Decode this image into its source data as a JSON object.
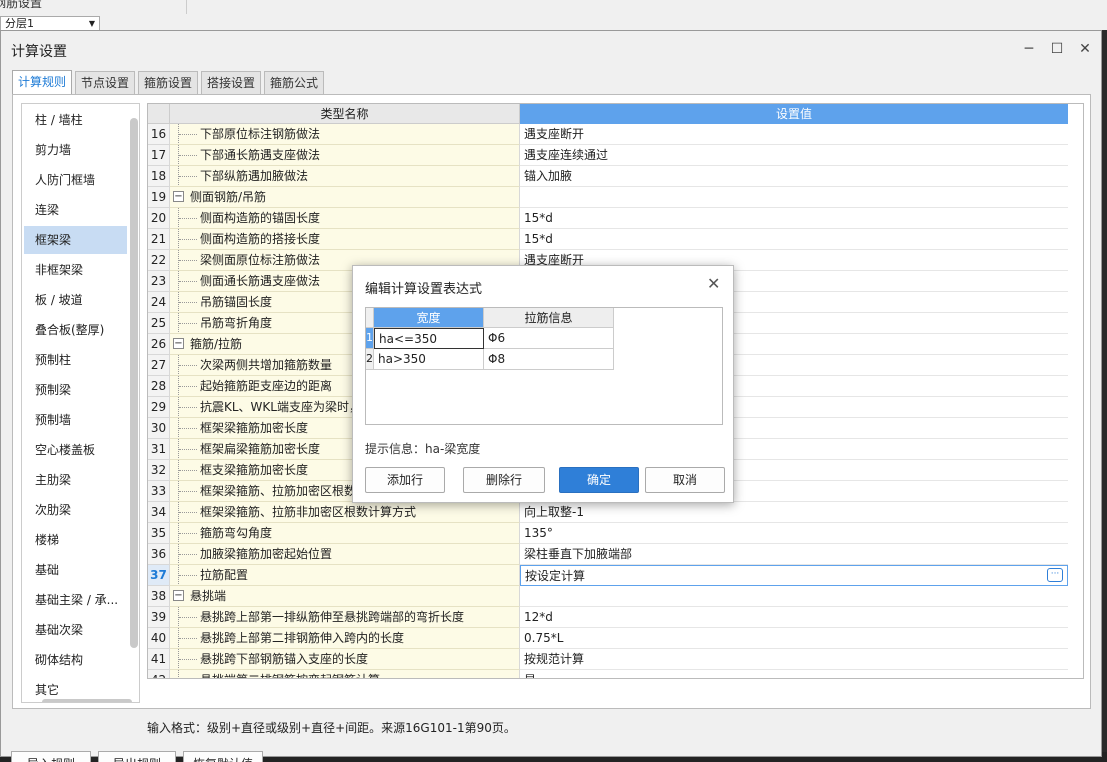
{
  "background": {
    "menu_text": "钢筋设置",
    "floor_select": "分层1"
  },
  "dialog": {
    "title": "计算设置",
    "window_controls": {
      "minimize": "─",
      "maximize": "☐",
      "close": "✕"
    },
    "tabs": [
      "计算规则",
      "节点设置",
      "箍筋设置",
      "搭接设置",
      "箍筋公式"
    ],
    "active_tab": 0,
    "categories": [
      "柱 / 墙柱",
      "剪力墙",
      "人防门框墙",
      "连梁",
      "框架梁",
      "非框架梁",
      "板 / 坡道",
      "叠合板(整厚)",
      "预制柱",
      "预制梁",
      "预制墙",
      "空心楼盖板",
      "主肋梁",
      "次肋梁",
      "楼梯",
      "基础",
      "基础主梁 / 承...",
      "基础次梁",
      "砌体结构",
      "其它"
    ],
    "selected_category": 4,
    "grid": {
      "header_name": "类型名称",
      "header_value": "设置值",
      "rows": [
        {
          "num": "16",
          "name": "下部原位标注钢筋做法",
          "value": "遇支座断开",
          "group": false
        },
        {
          "num": "17",
          "name": "下部通长筋遇支座做法",
          "value": "遇支座连续通过",
          "group": false
        },
        {
          "num": "18",
          "name": "下部纵筋遇加腋做法",
          "value": "锚入加腋",
          "group": false
        },
        {
          "num": "19",
          "name": "侧面钢筋/吊筋",
          "value": "",
          "group": true
        },
        {
          "num": "20",
          "name": "侧面构造筋的锚固长度",
          "value": "15*d",
          "group": false
        },
        {
          "num": "21",
          "name": "侧面构造筋的搭接长度",
          "value": "15*d",
          "group": false
        },
        {
          "num": "22",
          "name": "梁侧面原位标注筋做法",
          "value": "遇支座断开",
          "group": false
        },
        {
          "num": "23",
          "name": "侧面通长筋遇支座做法",
          "value": "",
          "group": false
        },
        {
          "num": "24",
          "name": "吊筋锚固长度",
          "value": "",
          "group": false
        },
        {
          "num": "25",
          "name": "吊筋弯折角度",
          "value": "",
          "group": false
        },
        {
          "num": "26",
          "name": "箍筋/拉筋",
          "value": "",
          "group": true
        },
        {
          "num": "27",
          "name": "次梁两侧共增加箍筋数量",
          "value": "",
          "group": false
        },
        {
          "num": "28",
          "name": "起始箍筋距支座边的距离",
          "value": "",
          "group": false
        },
        {
          "num": "29",
          "name": "抗震KL、WKL端支座为梁时，",
          "value": "",
          "group": false
        },
        {
          "num": "30",
          "name": "框架梁箍筋加密长度",
          "value": "",
          "group": false
        },
        {
          "num": "31",
          "name": "框架扁梁箍筋加密长度",
          "value": "",
          "group": false
        },
        {
          "num": "32",
          "name": "框支梁箍筋加密长度",
          "value": "",
          "group": false
        },
        {
          "num": "33",
          "name": "框架梁箍筋、拉筋加密区根数",
          "value": "",
          "group": false
        },
        {
          "num": "34",
          "name": "框架梁箍筋、拉筋非加密区根数计算方式",
          "value": "向上取整-1",
          "group": false
        },
        {
          "num": "35",
          "name": "箍筋弯勾角度",
          "value": "135°",
          "group": false
        },
        {
          "num": "36",
          "name": "加腋梁箍筋加密起始位置",
          "value": "梁柱垂直下加腋端部",
          "group": false
        },
        {
          "num": "37",
          "name": "拉筋配置",
          "value": "按设定计算",
          "group": false
        },
        {
          "num": "38",
          "name": "悬挑端",
          "value": "",
          "group": true
        },
        {
          "num": "39",
          "name": "悬挑跨上部第一排纵筋伸至悬挑跨端部的弯折长度",
          "value": "12*d",
          "group": false
        },
        {
          "num": "40",
          "name": "悬挑跨上部第二排钢筋伸入跨内的长度",
          "value": "0.75*L",
          "group": false
        },
        {
          "num": "41",
          "name": "悬挑跨下部钢筋锚入支座的长度",
          "value": "按规范计算",
          "group": false
        },
        {
          "num": "42",
          "name": "悬挑端第二排钢筋按弯起钢筋计算",
          "value": "是",
          "group": false
        }
      ],
      "selected_row": 21,
      "ellipsis": "···"
    },
    "hint": "输入格式：级别+直径或级别+直径+间距。来源16G101-1第90页。",
    "buttons": {
      "import": "导入规则",
      "export": "导出规则",
      "restore": "恢复默认值"
    }
  },
  "modal": {
    "title": "编辑计算设置表达式",
    "close": "✕",
    "col_width": "宽度",
    "col_info": "拉筋信息",
    "rows": [
      {
        "num": "1",
        "width": "ha<=350",
        "info": "Φ6"
      },
      {
        "num": "2",
        "width": "ha>350",
        "info": "Φ8"
      }
    ],
    "hint": "提示信息：ha-梁宽度",
    "add": "添加行",
    "delete": "删除行",
    "ok": "确定",
    "cancel": "取消"
  },
  "colors": {
    "accent": "#2f7fd8",
    "header_blue": "#5ea2ec",
    "selected": "#c8dcf3"
  }
}
